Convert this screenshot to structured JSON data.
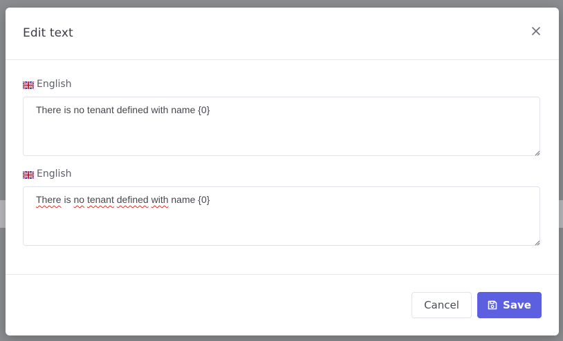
{
  "dialog": {
    "title": "Edit text",
    "close_icon": "close-icon"
  },
  "fields": [
    {
      "language": "English",
      "flag_icon": "uk-flag-icon",
      "value": "There is no tenant defined with name {0}"
    },
    {
      "language": "English",
      "flag_icon": "uk-flag-icon",
      "value_parts": [
        "There",
        " is ",
        "no",
        " ",
        "tenant",
        " ",
        "defined",
        " ",
        "with",
        " name {0}"
      ]
    }
  ],
  "footer": {
    "cancel_label": "Cancel",
    "save_label": "Save",
    "save_icon": "floppy-disk-icon"
  },
  "colors": {
    "primary": "#5b5fe0",
    "overlay": "#8b8d90"
  }
}
